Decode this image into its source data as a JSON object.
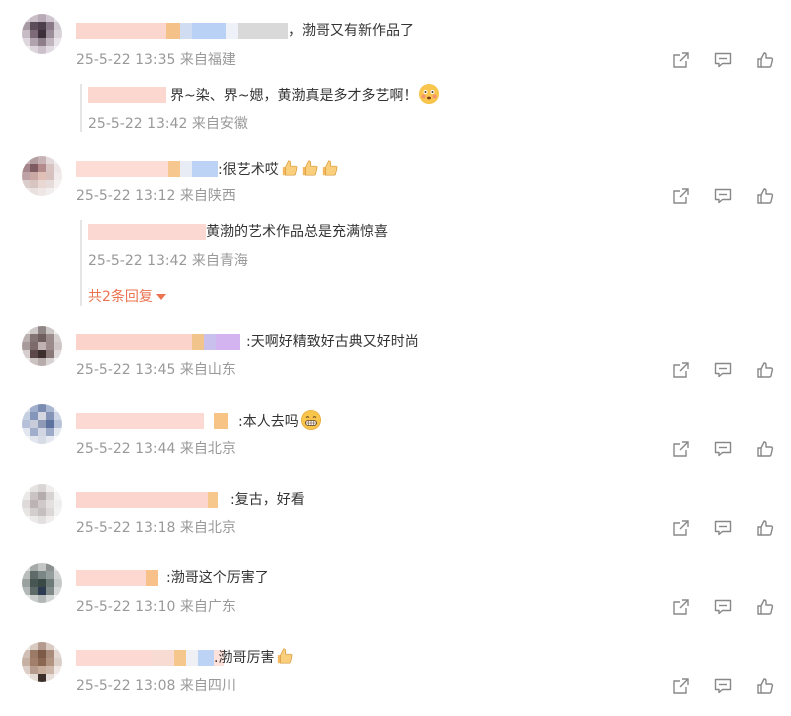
{
  "comments": [
    {
      "text": "，渤哥又有新作品了",
      "meta": "25-5-22 13:35 来自福建",
      "reply": {
        "text": "界~染、界~媤，黄渤真是多才多艺啊！",
        "meta": "25-5-22 13:42 来自安徽",
        "emoji": "flushed-emoji"
      }
    },
    {
      "text": ":很艺术哎",
      "emoji": "thumbs-up x3",
      "meta": "25-5-22 13:12 来自陕西",
      "reply": {
        "text": "黄渤的艺术作品总是充满惊喜",
        "meta": "25-5-22 13:42 来自青海"
      },
      "more": "共2条回复"
    },
    {
      "text": ":天啊好精致好古典又好时尚",
      "meta": "25-5-22 13:45 来自山东"
    },
    {
      "text": ":本人去吗",
      "emoji": "grin-emoji",
      "meta": "25-5-22 13:44 来自北京"
    },
    {
      "text": ":复古，好看",
      "meta": "25-5-22 13:18 来自北京"
    },
    {
      "text": ":渤哥这个厉害了",
      "meta": "25-5-22 13:10 来自广东"
    },
    {
      "text": ".渤哥厉害",
      "emoji": "thumbs-up",
      "meta": "25-5-22 13:08 来自四川"
    }
  ],
  "icons": {
    "share": "share-icon",
    "comment": "comment-icon",
    "like": "like-icon"
  },
  "colors": {
    "meta": "#999999",
    "text": "#333333",
    "more": "#eb7350",
    "icon": "#888888"
  }
}
